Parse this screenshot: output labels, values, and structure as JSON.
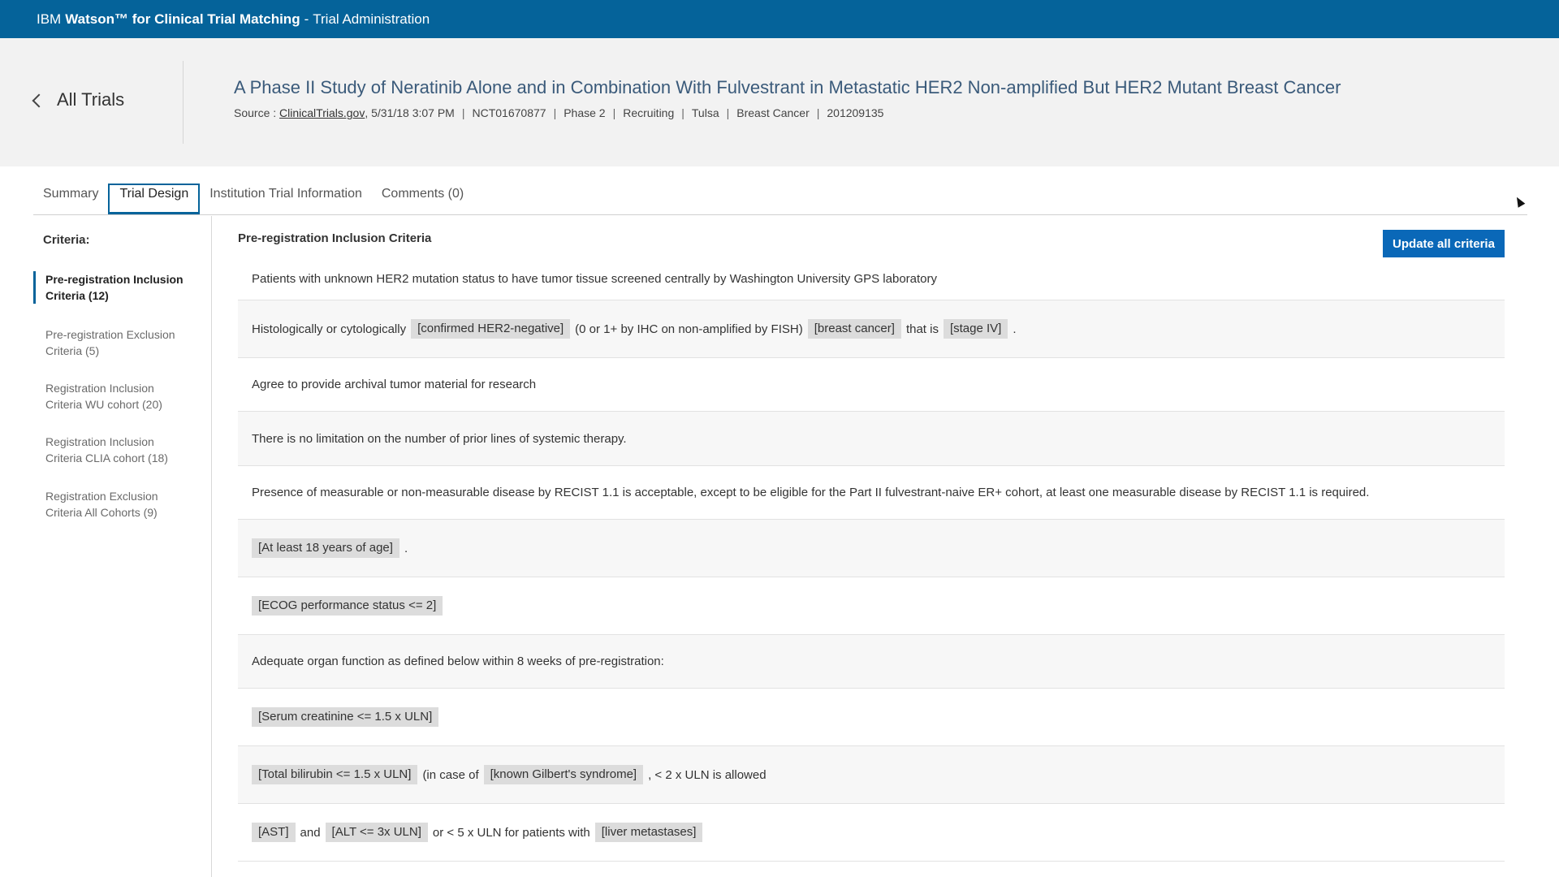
{
  "app": {
    "brand_ibm": "IBM",
    "brand_product": "Watson™ for Clinical Trial Matching",
    "brand_separator": "-",
    "brand_section": "Trial Administration",
    "accent_color": "#05639a"
  },
  "header": {
    "back_label": "All Trials",
    "title": "A Phase II Study of Neratinib Alone and in Combination With Fulvestrant in Metastatic HER2 Non-amplified But HER2 Mutant Breast Cancer",
    "source_prefix": "Source :",
    "source_link": "ClinicalTrials.gov",
    "source_date": ", 5/31/18 3:07 PM",
    "nct_id": "NCT01670877",
    "phase": "Phase 2",
    "status": "Recruiting",
    "location": "Tulsa",
    "disease": "Breast Cancer",
    "protocol_id": "201209135",
    "separator": "|"
  },
  "tabs": [
    {
      "label": "Summary"
    },
    {
      "label": "Trial Design"
    },
    {
      "label": "Institution Trial Information"
    },
    {
      "label": "Comments (0)"
    }
  ],
  "sidebar": {
    "heading": "Criteria:",
    "items": [
      {
        "line1": "Pre-registration Inclusion",
        "line2": "Criteria (12)"
      },
      {
        "line1": "Pre-registration Exclusion",
        "line2": "Criteria (5)"
      },
      {
        "line1": "Registration Inclusion",
        "line2": "Criteria WU cohort (20)"
      },
      {
        "line1": "Registration Inclusion",
        "line2": "Criteria CLIA cohort (18)"
      },
      {
        "line1": "Registration Exclusion",
        "line2": "Criteria All Cohorts (9)"
      }
    ]
  },
  "main": {
    "section_title": "Pre-registration Inclusion Criteria",
    "update_button": "Update all criteria",
    "rows": [
      {
        "t0": "Patients with unknown HER2 mutation status to have tumor tissue screened centrally by Washington University GPS laboratory"
      },
      {
        "t0": "Histologically or cytologically",
        "c0": "[confirmed HER2-negative]",
        "t1": "(0 or 1+ by IHC on non-amplified by FISH)",
        "c1": "[breast cancer]",
        "t2": "that is",
        "c2": "[stage IV]",
        "t3": "."
      },
      {
        "t0": "Agree to provide archival tumor material for research"
      },
      {
        "t0": "There is no limitation on the number of prior lines of systemic therapy."
      },
      {
        "t0": "Presence of measurable or non-measurable disease by RECIST 1.1 is acceptable, except to be eligible for the Part II fulvestrant-naive ER+ cohort, at least one measurable disease by RECIST 1.1 is required."
      },
      {
        "c0": "[At least 18 years of age]",
        "t0": "."
      },
      {
        "c0": "[ECOG performance status <= 2]"
      },
      {
        "t0": "Adequate organ function as defined below within 8 weeks of pre-registration:"
      },
      {
        "c0": "[Serum creatinine <= 1.5 x ULN]"
      },
      {
        "c0": "[Total bilirubin <= 1.5 x ULN]",
        "t0": "(in case of",
        "c1": "[known Gilbert's syndrome]",
        "t1": ", < 2 x ULN is allowed"
      },
      {
        "c0": "[AST]",
        "t0": "and",
        "c1": "[ALT <= 3x ULN]",
        "t1": "or < 5 x ULN for patients with",
        "c2": "[liver metastases]"
      }
    ]
  }
}
